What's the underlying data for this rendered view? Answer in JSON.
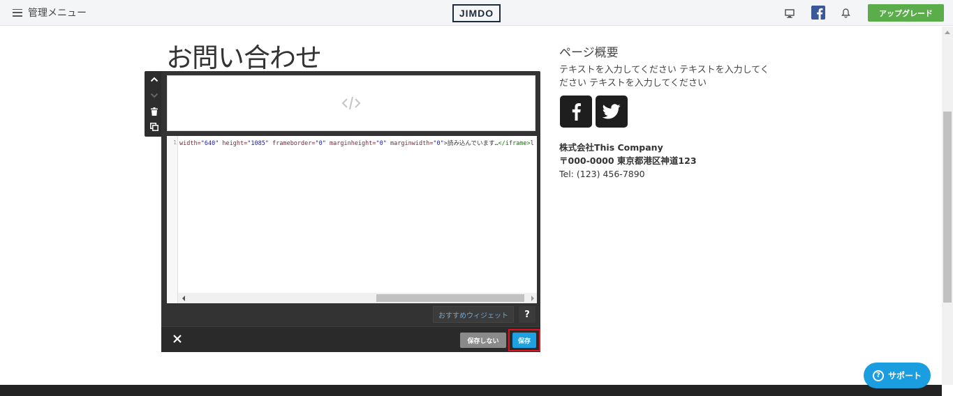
{
  "topbar": {
    "menu_label": "管理メニュー",
    "logo": "JIMDO",
    "upgrade_label": "アップグレード",
    "icons": [
      "monitor-icon",
      "facebook-icon",
      "bell-icon"
    ]
  },
  "page": {
    "title": "お問い合わせ"
  },
  "editor": {
    "code_line_number": "1",
    "code": {
      "a1": "width=",
      "v1": "\"640\"",
      "a2": " height=",
      "v2": "\"1085\"",
      "a3": " frameborder=",
      "v3": "\"0\"",
      "a4": " marginheight=",
      "v4": "\"0\"",
      "a5": " marginwidth=",
      "v5": "\"0\"",
      "text": ">読み込んでいます…",
      "tag": "</iframe>",
      "tail": "l"
    },
    "widget_label": "おすすめウィジェット",
    "help_label": "?",
    "nosave_label": "保存しない",
    "save_label": "保存"
  },
  "sidebar": {
    "title": "ページ概要",
    "text": "テキストを入力してください テキストを入力してください テキストを入力してください",
    "company_name": "株式会社This Company",
    "address": "〒000-0000 東京都港区神道123",
    "tel": "Tel: (123) 456-7890"
  },
  "support": {
    "label": "サポート",
    "icon_glyph": "?"
  },
  "colors": {
    "upgrade": "#5aad4a",
    "save": "#1fa0e0",
    "highlight": "#e0141e",
    "support": "#1a9ee0"
  }
}
